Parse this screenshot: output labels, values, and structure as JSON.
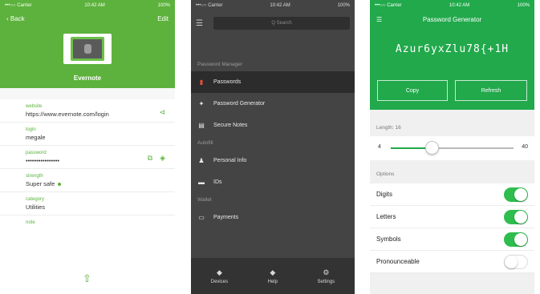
{
  "colors": {
    "entry_green": "#5cb23c",
    "generator_green": "#21a94b",
    "menu_dark": "#444444",
    "active_icon": "#e94e3b"
  },
  "entry_screen": {
    "status": {
      "carrier": "•••○○ Carrier",
      "time": "10:42 AM",
      "battery": "100%"
    },
    "nav": {
      "back": "Back",
      "edit": "Edit"
    },
    "title": "Evernote",
    "fields": [
      {
        "label": "website",
        "value": "https://www.evernote.com/login",
        "icon": "link-icon"
      },
      {
        "label": "login",
        "value": "megale"
      },
      {
        "label": "password",
        "value": "••••••••••••••••",
        "icons": [
          "copy-icon",
          "eye-icon"
        ]
      },
      {
        "label": "strength",
        "value": "Super safe"
      },
      {
        "label": "category",
        "value": "Utilities"
      },
      {
        "label": "note",
        "value": ""
      }
    ],
    "share_icon": "share-icon"
  },
  "menu_screen": {
    "status": {
      "carrier": "•••○○ Carrier",
      "time": "10:42 AM",
      "battery": "100%"
    },
    "search_placeholder": "Q Search",
    "sections": [
      {
        "title": "Password Manager",
        "items": [
          {
            "label": "Passwords",
            "icon": "key-icon",
            "active": true
          },
          {
            "label": "Password Generator",
            "icon": "wand-icon"
          },
          {
            "label": "Secure Notes",
            "icon": "note-icon"
          }
        ]
      },
      {
        "title": "Autofill",
        "items": [
          {
            "label": "Personal Info",
            "icon": "person-icon"
          },
          {
            "label": "IDs",
            "icon": "id-card-icon"
          }
        ]
      },
      {
        "title": "Wallet",
        "items": [
          {
            "label": "Payments",
            "icon": "card-icon"
          }
        ]
      }
    ],
    "tabs": [
      {
        "label": "Devices",
        "icon": "devices-icon"
      },
      {
        "label": "Help",
        "icon": "help-icon"
      },
      {
        "label": "Settings",
        "icon": "gear-icon"
      }
    ]
  },
  "generator_screen": {
    "status": {
      "carrier": "•••○○ Carrier",
      "time": "10:42 AM",
      "battery": "100%"
    },
    "title": "Password Generator",
    "password": "Azur6yxZlu78{+1H",
    "copy_label": "Copy",
    "refresh_label": "Refresh",
    "length_label": "Length: 16",
    "slider": {
      "min": 4,
      "max": 40,
      "value": 16
    },
    "options_label": "Options",
    "options": [
      {
        "label": "Digits",
        "on": true
      },
      {
        "label": "Letters",
        "on": true
      },
      {
        "label": "Symbols",
        "on": true
      },
      {
        "label": "Pronounceable",
        "on": false
      }
    ]
  }
}
